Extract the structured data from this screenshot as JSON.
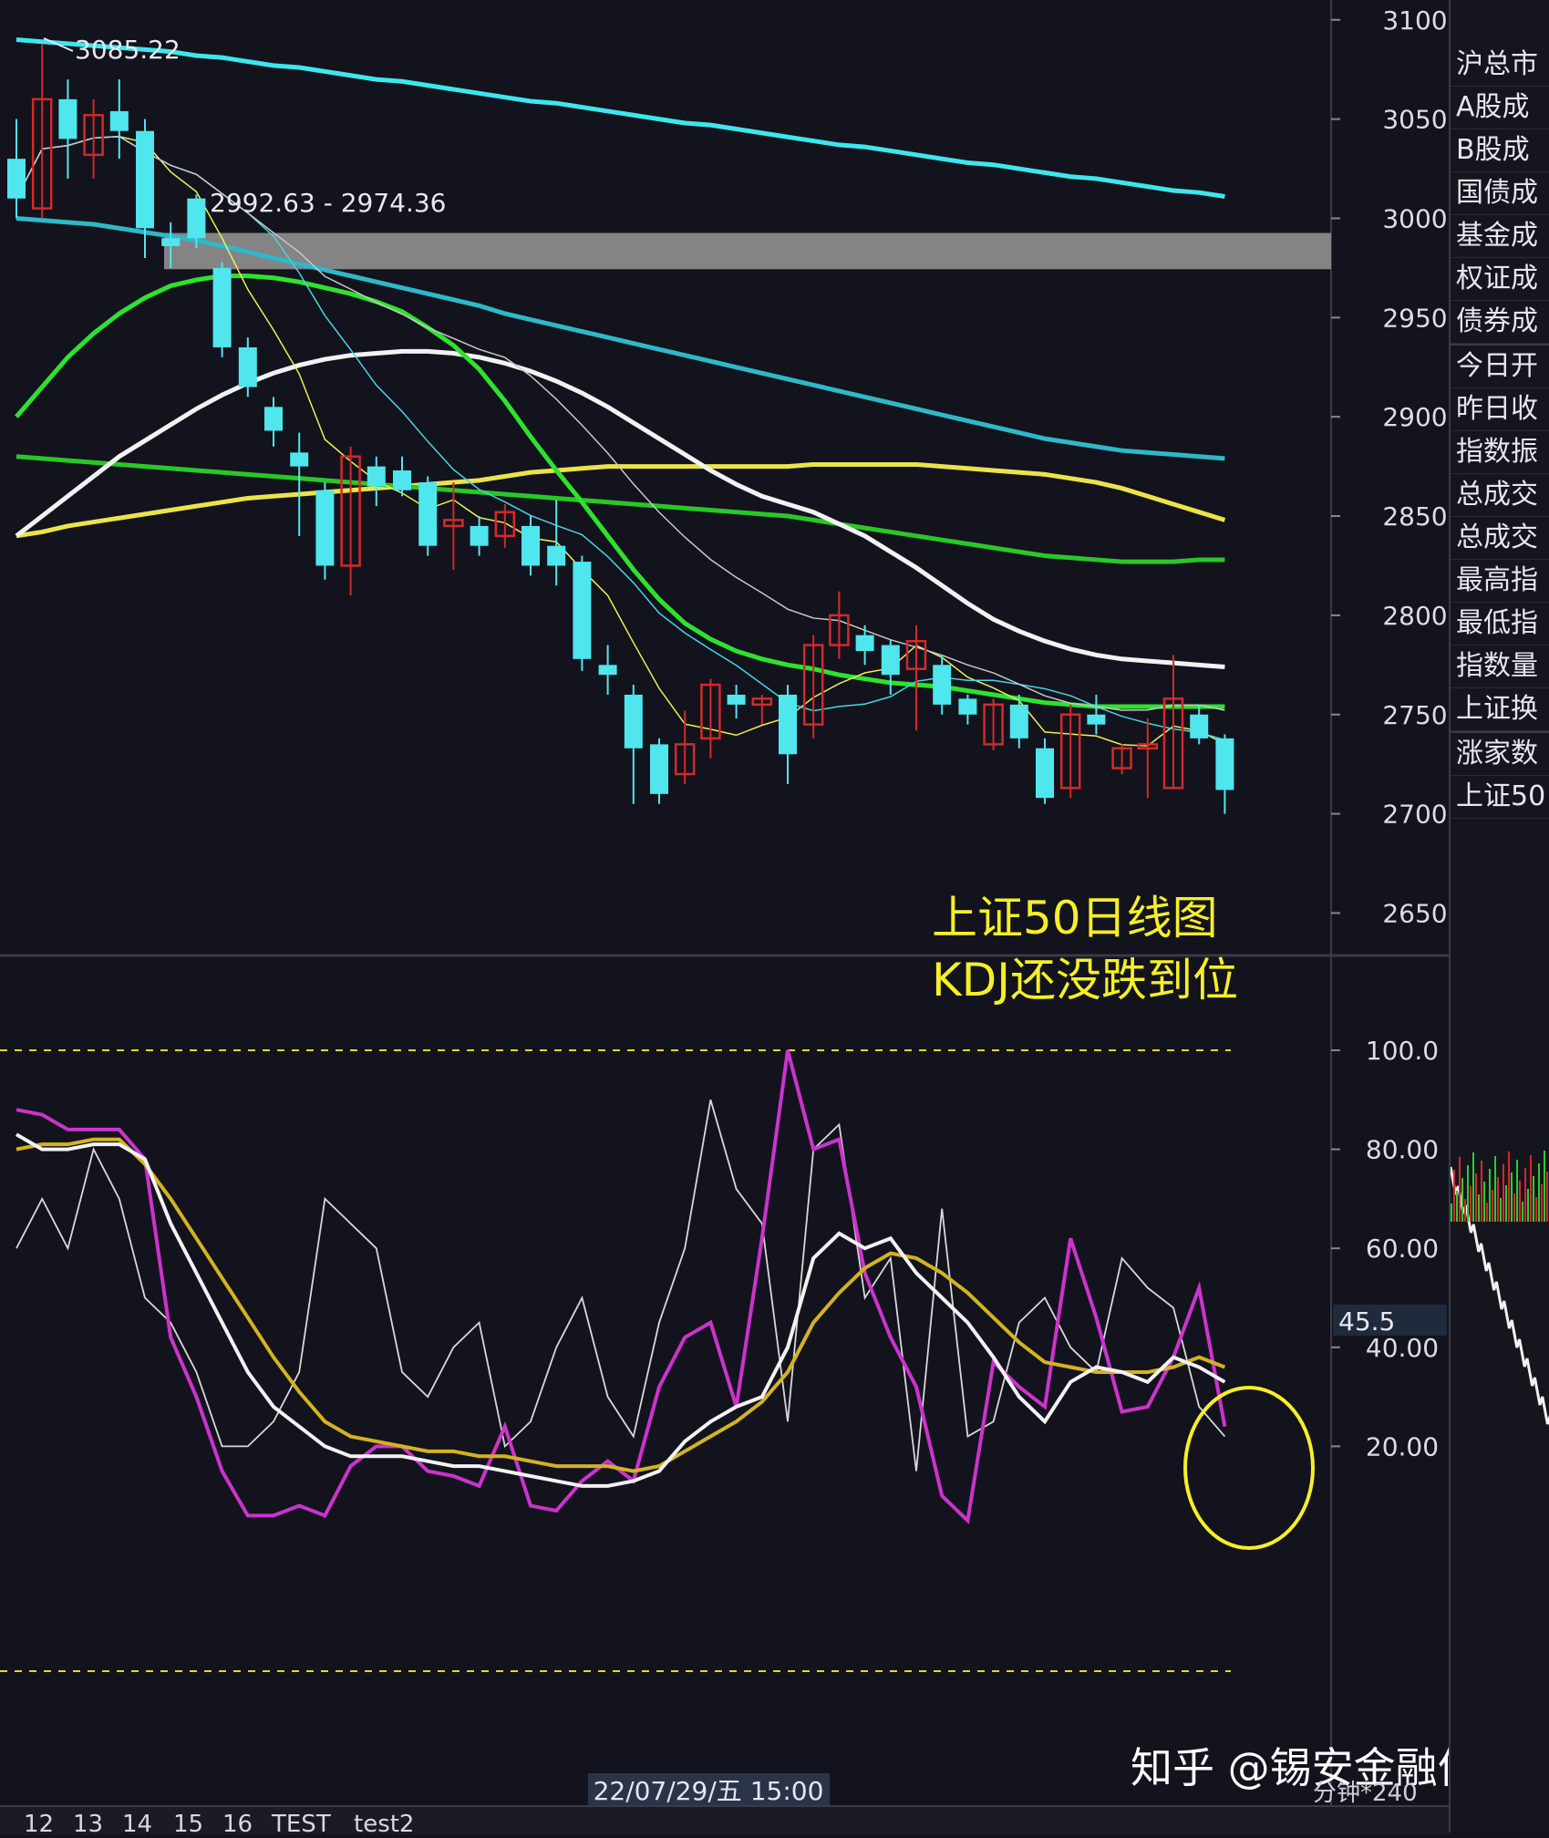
{
  "colors": {
    "bg": "#13131d",
    "up": "#d22a2a",
    "down": "#4fe6ee",
    "ma_cyan": "#3ee6ee",
    "ma_teal": "#2fb8c8",
    "ma_white": "#f2f2f2",
    "ma_yellow": "#ebe34a",
    "ma_green_bright": "#2ee22e",
    "ma_green": "#28c828",
    "k": "#f2f2f2",
    "d": "#d3b320",
    "j": "#cc33cc",
    "raw": "#d8d8d8",
    "annotation": "#f5ef28",
    "band": "#8a8a8a"
  },
  "price_axis": {
    "ticks": [
      "3100",
      "3050",
      "3000",
      "2950",
      "2900",
      "2850",
      "2800",
      "2750",
      "2700",
      "2650"
    ]
  },
  "kdj_axis": {
    "ticks": [
      "100.0",
      "80.00",
      "60.00",
      "40.00",
      "20.00"
    ],
    "current_value": "45.5"
  },
  "labels": {
    "high": "3085.22",
    "range": "2992.63 - 2974.36",
    "annotation_line1": "上证50日线图",
    "annotation_line2": "KDJ还没跌到位",
    "timestamp": "22/07/29/五 15:00",
    "watermark": "知乎 @锡安金融何",
    "minute_label": "分钟*240"
  },
  "side_panel": {
    "items": [
      "沪总市",
      "A股成",
      "B股成",
      "国债成",
      "基金成",
      "权证成",
      "债券成",
      "今日开",
      "昨日收",
      "指数振",
      "总成交",
      "总成交",
      "最高指",
      "最低指",
      "指数量",
      "上证换",
      "涨家数",
      "上证50"
    ]
  },
  "bottom_tabs": [
    "12",
    "13",
    "14",
    "15",
    "16",
    "TEST",
    "test2"
  ],
  "chart_data": {
    "type": "candlestick",
    "price_range": [
      2630,
      3110
    ],
    "resistance_band": [
      2974.36,
      2992.63
    ],
    "candles": [
      {
        "o": 3030,
        "c": 3010,
        "h": 3050,
        "l": 3000
      },
      {
        "o": 3005,
        "c": 3060,
        "h": 3088,
        "l": 3000
      },
      {
        "o": 3060,
        "c": 3040,
        "h": 3070,
        "l": 3020
      },
      {
        "o": 3032,
        "c": 3052,
        "h": 3060,
        "l": 3020
      },
      {
        "o": 3054,
        "c": 3044,
        "h": 3070,
        "l": 3030
      },
      {
        "o": 3044,
        "c": 2995,
        "h": 3050,
        "l": 2980
      },
      {
        "o": 2990,
        "c": 2986,
        "h": 2998,
        "l": 2975
      },
      {
        "o": 3010,
        "c": 2990,
        "h": 3012,
        "l": 2985
      },
      {
        "o": 2975,
        "c": 2935,
        "h": 2978,
        "l": 2930
      },
      {
        "o": 2935,
        "c": 2915,
        "h": 2940,
        "l": 2910
      },
      {
        "o": 2905,
        "c": 2893,
        "h": 2910,
        "l": 2885
      },
      {
        "o": 2882,
        "c": 2875,
        "h": 2892,
        "l": 2840
      },
      {
        "o": 2863,
        "c": 2825,
        "h": 2867,
        "l": 2818
      },
      {
        "o": 2825,
        "c": 2880,
        "h": 2885,
        "l": 2810
      },
      {
        "o": 2875,
        "c": 2865,
        "h": 2880,
        "l": 2855
      },
      {
        "o": 2873,
        "c": 2863,
        "h": 2880,
        "l": 2860
      },
      {
        "o": 2867,
        "c": 2835,
        "h": 2870,
        "l": 2830
      },
      {
        "o": 2845,
        "c": 2848,
        "h": 2867,
        "l": 2823
      },
      {
        "o": 2845,
        "c": 2835,
        "h": 2850,
        "l": 2830
      },
      {
        "o": 2840,
        "c": 2852,
        "h": 2856,
        "l": 2834
      },
      {
        "o": 2845,
        "c": 2825,
        "h": 2850,
        "l": 2820
      },
      {
        "o": 2835,
        "c": 2825,
        "h": 2858,
        "l": 2815
      },
      {
        "o": 2827,
        "c": 2778,
        "h": 2830,
        "l": 2772
      },
      {
        "o": 2775,
        "c": 2770,
        "h": 2785,
        "l": 2760
      },
      {
        "o": 2760,
        "c": 2733,
        "h": 2765,
        "l": 2705
      },
      {
        "o": 2735,
        "c": 2710,
        "h": 2738,
        "l": 2705
      },
      {
        "o": 2720,
        "c": 2735,
        "h": 2752,
        "l": 2715
      },
      {
        "o": 2738,
        "c": 2765,
        "h": 2768,
        "l": 2728
      },
      {
        "o": 2760,
        "c": 2755,
        "h": 2765,
        "l": 2748
      },
      {
        "o": 2755,
        "c": 2758,
        "h": 2760,
        "l": 2745
      },
      {
        "o": 2760,
        "c": 2730,
        "h": 2765,
        "l": 2715
      },
      {
        "o": 2745,
        "c": 2785,
        "h": 2790,
        "l": 2738
      },
      {
        "o": 2785,
        "c": 2800,
        "h": 2812,
        "l": 2778
      },
      {
        "o": 2790,
        "c": 2782,
        "h": 2795,
        "l": 2775
      },
      {
        "o": 2785,
        "c": 2770,
        "h": 2788,
        "l": 2760
      },
      {
        "o": 2773,
        "c": 2787,
        "h": 2795,
        "l": 2742
      },
      {
        "o": 2775,
        "c": 2755,
        "h": 2780,
        "l": 2750
      },
      {
        "o": 2758,
        "c": 2750,
        "h": 2760,
        "l": 2745
      },
      {
        "o": 2735,
        "c": 2755,
        "h": 2758,
        "l": 2732
      },
      {
        "o": 2755,
        "c": 2738,
        "h": 2760,
        "l": 2733
      },
      {
        "o": 2733,
        "c": 2708,
        "h": 2738,
        "l": 2705
      },
      {
        "o": 2713,
        "c": 2750,
        "h": 2755,
        "l": 2708
      },
      {
        "o": 2750,
        "c": 2745,
        "h": 2760,
        "l": 2740
      },
      {
        "o": 2723,
        "c": 2733,
        "h": 2735,
        "l": 2720
      },
      {
        "o": 2733,
        "c": 2735,
        "h": 2748,
        "l": 2708
      },
      {
        "o": 2713,
        "c": 2758,
        "h": 2780,
        "l": 2713
      },
      {
        "o": 2750,
        "c": 2738,
        "h": 2755,
        "l": 2735
      },
      {
        "o": 2738,
        "c": 2712,
        "h": 2740,
        "l": 2700
      }
    ],
    "ma_lines": [
      {
        "name": "",
        "color": "ma_cyan",
        "values": [
          3090,
          3089,
          3088,
          3087,
          3086,
          3085,
          3084,
          3082,
          3081,
          3079,
          3077,
          3076,
          3074,
          3072,
          3070,
          3069,
          3067,
          3065,
          3063,
          3061,
          3059,
          3058,
          3056,
          3054,
          3052,
          3050,
          3048,
          3047,
          3045,
          3043,
          3041,
          3039,
          3037,
          3036,
          3034,
          3032,
          3030,
          3028,
          3027,
          3025,
          3023,
          3021,
          3020,
          3018,
          3016,
          3014,
          3013,
          3011
        ]
      },
      {
        "name": "",
        "color": "ma_teal",
        "values": [
          3000,
          2999,
          2998,
          2997,
          2995,
          2993,
          2991,
          2989,
          2986,
          2983,
          2980,
          2977,
          2974,
          2971,
          2968,
          2965,
          2962,
          2959,
          2956,
          2952,
          2949,
          2946,
          2943,
          2940,
          2937,
          2934,
          2931,
          2928,
          2925,
          2922,
          2919,
          2916,
          2913,
          2910,
          2907,
          2904,
          2901,
          2898,
          2895,
          2892,
          2889,
          2887,
          2885,
          2883,
          2882,
          2881,
          2880,
          2879
        ]
      },
      {
        "name": "",
        "color": "ma_yellow",
        "values": [
          2840,
          2842,
          2845,
          2847,
          2849,
          2851,
          2853,
          2855,
          2857,
          2859,
          2860,
          2861,
          2862,
          2863,
          2864,
          2865,
          2866,
          2867,
          2868,
          2870,
          2872,
          2873,
          2874,
          2875,
          2875,
          2875,
          2875,
          2875,
          2875,
          2875,
          2875,
          2876,
          2876,
          2876,
          2876,
          2876,
          2875,
          2874,
          2873,
          2872,
          2871,
          2869,
          2867,
          2864,
          2860,
          2856,
          2852,
          2848
        ]
      },
      {
        "name": "",
        "color": "ma_green",
        "values": [
          2880,
          2879,
          2878,
          2877,
          2876,
          2875,
          2874,
          2873,
          2872,
          2871,
          2870,
          2869,
          2868,
          2867,
          2866,
          2865,
          2864,
          2863,
          2862,
          2861,
          2860,
          2859,
          2858,
          2857,
          2856,
          2855,
          2854,
          2853,
          2852,
          2851,
          2850,
          2848,
          2846,
          2844,
          2842,
          2840,
          2838,
          2836,
          2834,
          2832,
          2830,
          2829,
          2828,
          2827,
          2827,
          2827,
          2828,
          2828
        ]
      },
      {
        "name": "",
        "color": "ma_white",
        "values": [
          2840,
          2850,
          2860,
          2870,
          2880,
          2888,
          2896,
          2904,
          2911,
          2917,
          2922,
          2926,
          2929,
          2931,
          2932,
          2933,
          2933,
          2932,
          2930,
          2927,
          2923,
          2918,
          2912,
          2905,
          2897,
          2889,
          2881,
          2873,
          2866,
          2860,
          2856,
          2852,
          2846,
          2840,
          2832,
          2824,
          2815,
          2806,
          2798,
          2792,
          2787,
          2783,
          2780,
          2778,
          2777,
          2776,
          2775,
          2774
        ]
      },
      {
        "name": "",
        "color": "ma_green_bright",
        "values": [
          2900,
          2915,
          2930,
          2942,
          2952,
          2960,
          2966,
          2969,
          2971,
          2971,
          2970,
          2968,
          2965,
          2962,
          2958,
          2953,
          2945,
          2936,
          2924,
          2908,
          2890,
          2873,
          2857,
          2840,
          2823,
          2808,
          2796,
          2788,
          2782,
          2778,
          2775,
          2773,
          2770,
          2768,
          2766,
          2765,
          2764,
          2762,
          2760,
          2758,
          2756,
          2755,
          2754,
          2754,
          2754,
          2754,
          2754,
          2754
        ]
      }
    ],
    "kdj": {
      "k": [
        83,
        80,
        80,
        81,
        81,
        78,
        65,
        55,
        45,
        35,
        28,
        24,
        20,
        18,
        18,
        18,
        17,
        16,
        16,
        15,
        14,
        13,
        12,
        12,
        13,
        15,
        21,
        25,
        28,
        30,
        40,
        58,
        63,
        60,
        62,
        55,
        50,
        45,
        38,
        30,
        25,
        33,
        36,
        35,
        33,
        38,
        36,
        33
      ],
      "d": [
        80,
        81,
        81,
        82,
        82,
        77,
        70,
        62,
        54,
        46,
        38,
        31,
        25,
        22,
        21,
        20,
        19,
        19,
        18,
        18,
        17,
        16,
        16,
        16,
        15,
        16,
        19,
        22,
        25,
        29,
        35,
        45,
        51,
        56,
        59,
        58,
        55,
        51,
        46,
        41,
        37,
        36,
        35,
        35,
        35,
        36,
        38,
        36
      ],
      "j": [
        88,
        87,
        84,
        84,
        84,
        78,
        42,
        30,
        15,
        6,
        6,
        8,
        6,
        16,
        20,
        20,
        15,
        14,
        12,
        24,
        8,
        7,
        13,
        17,
        13,
        32,
        42,
        45,
        28,
        62,
        100,
        80,
        82,
        55,
        42,
        32,
        10,
        5,
        37,
        32,
        28,
        62,
        46,
        27,
        28,
        38,
        52,
        24
      ],
      "raw": [
        60,
        70,
        60,
        80,
        70,
        50,
        45,
        35,
        20,
        20,
        25,
        35,
        70,
        65,
        60,
        35,
        30,
        40,
        45,
        20,
        25,
        40,
        50,
        30,
        22,
        45,
        60,
        90,
        72,
        65,
        25,
        80,
        85,
        50,
        58,
        15,
        68,
        22,
        25,
        45,
        50,
        40,
        35,
        58,
        52,
        48,
        28,
        22
      ]
    }
  }
}
